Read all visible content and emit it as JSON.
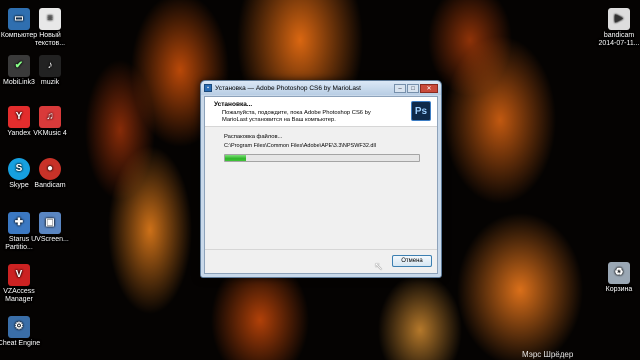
{
  "desktop": {
    "icons": [
      {
        "label": "Компьютер",
        "icon": "computer-icon",
        "color": "#2f6fb0"
      },
      {
        "label": "Новый\nтекстов...",
        "icon": "text-file-icon",
        "color": "#e8e8e8"
      },
      {
        "label": "MobiLink3",
        "icon": "mobilink-icon",
        "color": "#3a3a3a"
      },
      {
        "label": "muzik",
        "icon": "folder-icon",
        "color": "#222222"
      },
      {
        "label": "Yandex",
        "icon": "yandex-icon",
        "color": "#e32d2d"
      },
      {
        "label": "VKMusic 4",
        "icon": "vkmusic-icon",
        "color": "#d93a3a"
      },
      {
        "label": "Skype",
        "icon": "skype-icon",
        "color": "#16a0e0"
      },
      {
        "label": "Bandicam",
        "icon": "bandicam-icon",
        "color": "#c83228"
      },
      {
        "label": "Starus\nPartitio...",
        "icon": "starus-icon",
        "color": "#3b78c2"
      },
      {
        "label": "UVScreen...",
        "icon": "uvscreen-icon",
        "color": "#5a86c2"
      },
      {
        "label": "VZAccess\nManager",
        "icon": "vzaccess-icon",
        "color": "#cc2222"
      },
      {
        "label": "Cheat Engine",
        "icon": "cheat-engine-icon",
        "color": "#3a6ea8"
      },
      {
        "label": "bandicam\n2014-07-11...",
        "icon": "video-file-icon",
        "color": "#dddddd"
      },
      {
        "label": "Корзина",
        "icon": "recycle-bin-icon",
        "color": "#9aa7b4"
      }
    ],
    "watermark": "Мэрс Шрёдер"
  },
  "window": {
    "title": "Установка — Adobe Photoshop CS6 by MarioLast",
    "header_title": "Установка...",
    "header_subtitle": "Пожалуйста, подождите, пока Adobe Photoshop CS6 by MarioLast установится на Ваш компьютер.",
    "logo_text": "Ps",
    "status": "Распаковка файлов...",
    "current_file": "C:\\Program Files\\Common Files\\Adobe\\APE\\3.3\\NPSWF32.dll",
    "progress_percent": 11,
    "cancel_label": "Отмена",
    "controls": {
      "minimize": "–",
      "maximize": "□",
      "close": "✕"
    }
  }
}
